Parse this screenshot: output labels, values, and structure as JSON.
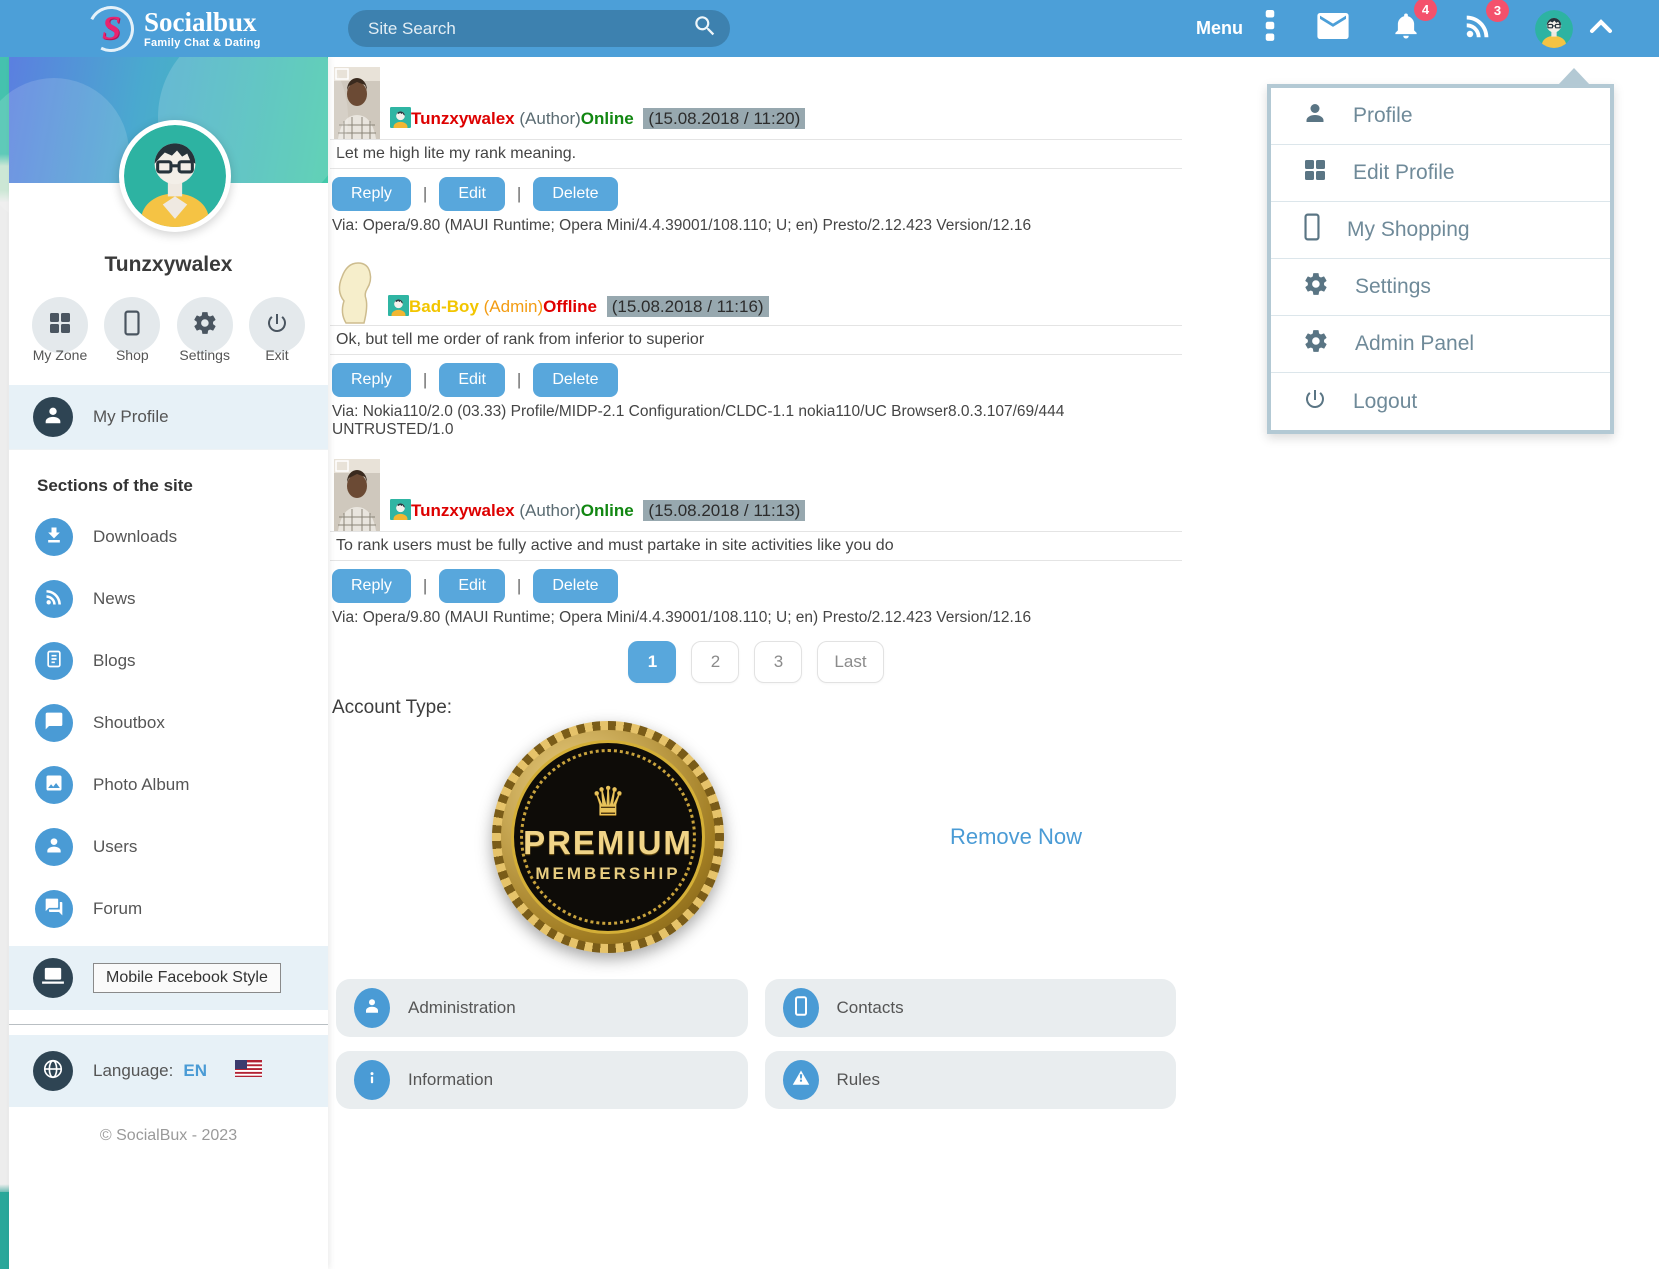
{
  "colors": {
    "header_blue": "#4c9fd8",
    "accent_blue": "#58a7dc",
    "dark_slate": "#2e4453",
    "row_highlight": "#e7f1f7",
    "badge_red": "#f4516c",
    "author_red": "#dd0000",
    "author_gold": "#f2c500",
    "admin_orange": "#f39c12",
    "online_green": "#128712",
    "offline_red": "#e00000",
    "timestamp_bg": "#97a8af",
    "link_blue": "#4a9bd5"
  },
  "header": {
    "brand_name": "Socialbux",
    "brand_tagline": "Family Chat & Dating",
    "search_placeholder": "Site Search",
    "menu_label": "Menu",
    "notification_count": "4",
    "feed_count": "3"
  },
  "sidebar": {
    "username": "Tunzxywalex",
    "quick_actions": [
      {
        "label": "My Zone",
        "icon": "grid-icon"
      },
      {
        "label": "Shop",
        "icon": "phone-icon"
      },
      {
        "label": "Settings",
        "icon": "gear-icon"
      },
      {
        "label": "Exit",
        "icon": "power-icon"
      }
    ],
    "my_profile_label": "My Profile",
    "sections_title": "Sections of the site",
    "nav": [
      {
        "label": "Downloads",
        "icon": "download-icon"
      },
      {
        "label": "News",
        "icon": "rss-icon"
      },
      {
        "label": "Blogs",
        "icon": "blog-icon"
      },
      {
        "label": "Shoutbox",
        "icon": "chat-bubble-icon"
      },
      {
        "label": "Photo Album",
        "icon": "photo-icon"
      },
      {
        "label": "Users",
        "icon": "user-icon"
      },
      {
        "label": "Forum",
        "icon": "forum-icon"
      }
    ],
    "style_button_label": "Mobile Facebook Style",
    "language_label": "Language:",
    "language_value": "EN",
    "copyright": "© SocialBux - 2023"
  },
  "posts": [
    {
      "author": "Tunzxywalex",
      "role": "(Author)",
      "status": "Online",
      "timestamp": "(15.08.2018 / 11:20)",
      "message": "Let me high lite my rank meaning.",
      "via": "Via: Opera/9.80 (MAUI Runtime; Opera Mini/4.4.39001/108.110; U; en) Presto/2.12.423 Version/12.16"
    },
    {
      "author": "Bad-Boy",
      "role": "(Admin)",
      "status": "Offline",
      "timestamp": "(15.08.2018 / 11:16)",
      "message": "Ok, but tell me order of rank from inferior to superior",
      "via": "Via: Nokia110/2.0 (03.33) Profile/MIDP-2.1 Configuration/CLDC-1.1 nokia110/UC Browser8.0.3.107/69/444 UNTRUSTED/1.0"
    },
    {
      "author": "Tunzxywalex",
      "role": "(Author)",
      "status": "Online",
      "timestamp": "(15.08.2018 / 11:13)",
      "message": "To rank users must be fully active and must partake in site activities like you do",
      "via": "Via: Opera/9.80 (MAUI Runtime; Opera Mini/4.4.39001/108.110; U; en) Presto/2.12.423 Version/12.16"
    }
  ],
  "post_actions": {
    "reply": "Reply",
    "edit": "Edit",
    "delete": "Delete",
    "separator": "|"
  },
  "pagination": {
    "pages": [
      "1",
      "2",
      "3",
      "Last"
    ],
    "active": "1"
  },
  "account": {
    "label": "Account Type:",
    "badge_line1": "PREMIUM",
    "badge_line2": "MEMBERSHIP",
    "badge_crown": "♛",
    "remove_link": "Remove Now"
  },
  "footer_boxes": [
    {
      "label": "Administration",
      "icon": "admin-user-icon"
    },
    {
      "label": "Contacts",
      "icon": "phone-icon"
    },
    {
      "label": "Information",
      "icon": "info-icon"
    },
    {
      "label": "Rules",
      "icon": "warning-icon"
    }
  ],
  "dropdown": {
    "items": [
      {
        "label": "Profile",
        "icon": "user-icon"
      },
      {
        "label": "Edit Profile",
        "icon": "grid-icon"
      },
      {
        "label": "My Shopping",
        "icon": "phone-icon"
      },
      {
        "label": "Settings",
        "icon": "gear-icon"
      },
      {
        "label": "Admin Panel",
        "icon": "gear-icon"
      },
      {
        "label": "Logout",
        "icon": "power-icon"
      }
    ]
  }
}
